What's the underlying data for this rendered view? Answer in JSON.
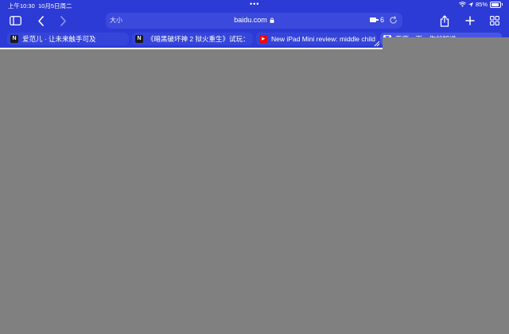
{
  "status_bar": {
    "time": "上午10:30",
    "date": "10月5日周二",
    "more": "•••",
    "battery_percent_text": "85%",
    "battery_level": 0.85
  },
  "toolbar": {
    "sidebar_icon": "sidebar-icon",
    "back_icon": "chevron-left-icon",
    "forward_icon": "chevron-right-icon",
    "share_icon": "share-icon",
    "new_tab_icon": "plus-icon",
    "tab_overview_icon": "grid-icon"
  },
  "address_bar": {
    "text_size_label": "大小",
    "url": "baidu.com",
    "extension_count": "6"
  },
  "tabs": [
    {
      "title": "爱范儿 · 让未来触手可及",
      "favicon": "N"
    },
    {
      "title": "《暗黑破坏神 2 狱火重生》试玩：",
      "favicon": "N"
    },
    {
      "title": "New iPad Mini review: middle child",
      "favicon": "▶"
    },
    {
      "title": "百度一下，你就知道",
      "favicon": "百"
    }
  ],
  "colors": {
    "chrome_background": "#2c3bd6",
    "page_background": "#808080",
    "youtube_red": "#ff0000"
  }
}
